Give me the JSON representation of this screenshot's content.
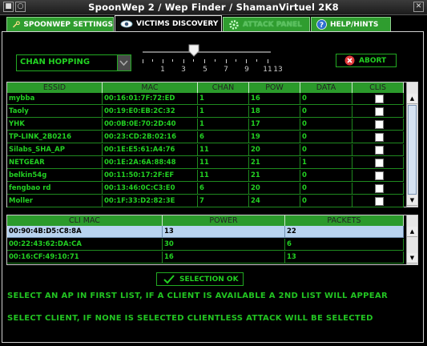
{
  "window": {
    "title": "SpoonWep 2 / Wep Finder / ShamanVirtuel 2K8",
    "close_glyph": "✕"
  },
  "tabs": [
    {
      "label": "SPOONWEP SETTINGS",
      "icon": "wrench-icon"
    },
    {
      "label": "VICTIMS DISCOVERY",
      "icon": "eye-icon"
    },
    {
      "label": "ATTACK PANEL",
      "icon": "gear-icon"
    },
    {
      "label": "HELP/HINTS",
      "icon": "help-icon"
    }
  ],
  "controls": {
    "channel_mode": "CHAN HOPPING",
    "slider_value": 7,
    "slider_labels": [
      "1",
      "3",
      "5",
      "7",
      "9",
      "11",
      "13"
    ],
    "abort_label": "ABORT",
    "selection_ok_label": "SELECTION OK"
  },
  "ap_table": {
    "columns": [
      "ESSID",
      "MAC",
      "CHAN",
      "POW",
      "DATA",
      "CLIS"
    ],
    "rows": [
      [
        "mybba",
        "00:16:01:7F:72:ED",
        "1",
        "16",
        "0"
      ],
      [
        "Taoly",
        "00:19:E0:EB:2C:32",
        "1",
        "18",
        "0"
      ],
      [
        "YHK",
        "00:0B:0E:70:2D:40",
        "1",
        "17",
        "0"
      ],
      [
        "TP-LINK_2B0216",
        "00:23:CD:2B:02:16",
        "6",
        "19",
        "0"
      ],
      [
        "Silabs_SHA_AP",
        "00:1E:E5:61:A4:76",
        "11",
        "20",
        "0"
      ],
      [
        "NETGEAR",
        "00:1E:2A:6A:88:48",
        "11",
        "21",
        "1"
      ],
      [
        "belkin54g",
        "00:11:50:17:2F:EF",
        "11",
        "21",
        "0"
      ],
      [
        "fengbao rd",
        "00:13:46:0C:C3:E0",
        "6",
        "20",
        "0"
      ],
      [
        "Moller",
        "00:1F:33:D2:82:3E",
        "7",
        "24",
        "0"
      ]
    ]
  },
  "client_table": {
    "columns": [
      "CLI MAC",
      "POWER",
      "PACKETS"
    ],
    "rows": [
      [
        "00:90:4B:D5:C8:8A",
        "13",
        "22"
      ],
      [
        "00:22:43:62:DA:CA",
        "30",
        "6"
      ],
      [
        "00:16:CF:49:10:71",
        "16",
        "13"
      ]
    ],
    "selected_row": 0
  },
  "hints": [
    "SELECT AN AP IN FIRST LIST, IF A CLIENT IS AVAILABLE A 2ND LIST WILL APPEAR",
    "SELECT CLIENT, IF NONE IS SELECTED CLIENTLESS ATTACK WILL BE SELECTED"
  ],
  "colors": {
    "accent_green": "#22d022",
    "header_green": "#2b9a2b",
    "selection_blue": "#b8d3ef"
  }
}
